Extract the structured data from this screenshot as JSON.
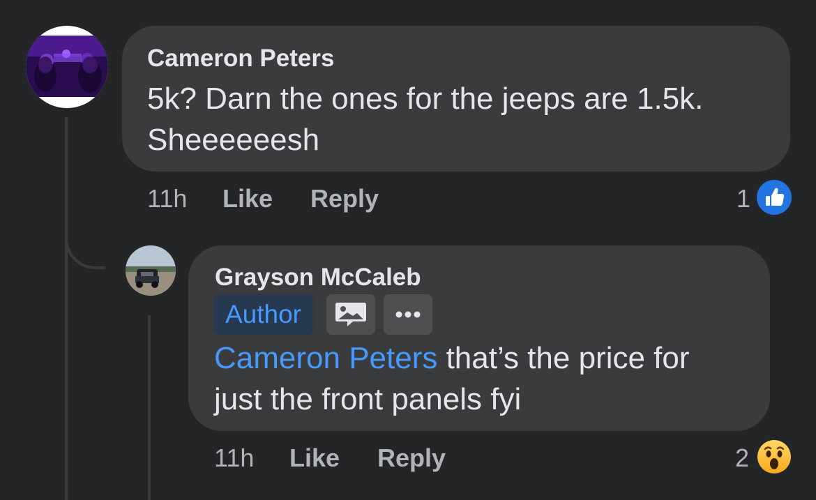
{
  "comments": [
    {
      "author": "Cameron Peters",
      "text_lines": [
        "5k? Darn the ones for the jeeps  are 1.5k.",
        "Sheeeeeesh"
      ],
      "time": "11h",
      "like_label": "Like",
      "reply_label": "Reply",
      "reaction_count": "1",
      "reaction_icon": "like-thumb-icon",
      "reaction_color": "#2374e1"
    },
    {
      "author": "Grayson McCaleb",
      "badge": "Author",
      "mention": "Cameron Peters",
      "text_line1_rest": " that’s the price for",
      "text_line2": "just the front panels fyi",
      "time": "11h",
      "like_label": "Like",
      "reply_label": "Reply",
      "reaction_count": "2",
      "reaction_icon": "wow-face-icon",
      "reaction_color": "#f7b125"
    }
  ],
  "colors": {
    "background": "#242526",
    "bubble": "#3a3b3c",
    "primary_text": "#e4e6eb",
    "secondary_text": "#b0b3b8",
    "link": "#4599ff",
    "badge_bg": "#263951"
  }
}
